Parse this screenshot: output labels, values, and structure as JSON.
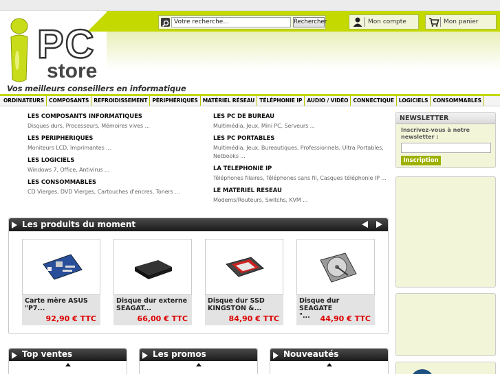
{
  "header": {
    "logo_alt": "PC store",
    "tagline": "Vos meilleurs conseillers en informatique",
    "search_placeholder": "Votre recherche...",
    "search_button": "Rechercher",
    "account_label": "Mon compte",
    "cart_label": "Mon panier"
  },
  "nav": [
    "ORDINATEURS",
    "COMPOSANTS",
    "REFROIDISSEMENT",
    "PÉRIPHÉRIQUES",
    "MATÉRIEL RÉSEAU",
    "TÉLÉPHONIE IP",
    "AUDIO / VIDÉO",
    "CONNECTIQUE",
    "LOGICIELS",
    "CONSOMMABLES"
  ],
  "categories_left": [
    {
      "title": "LES COMPOSANTS INFORMATIQUES",
      "sub": "Disques durs, Processeurs, Mémoires vives ..."
    },
    {
      "title": "LES PERIPHERIQUES",
      "sub": "Moniteurs LCD, Imprimantes ..."
    },
    {
      "title": "LES LOGICIELS",
      "sub": "Windows 7, Office, Antivirus ..."
    },
    {
      "title": "LES CONSOMMABLES",
      "sub": "CD Vierges, DVD Vierges, Cartouches d'encres, Toners ..."
    }
  ],
  "categories_right": [
    {
      "title": "LES PC DE BUREAU",
      "sub": "Multimédia, Jeux, Mini PC, Serveurs ..."
    },
    {
      "title": "LES PC PORTABLES",
      "sub": "Multimédia, Jeux, Bureautiques, Professionnels, Ultra Portables,",
      "sub2": "Netbooks ..."
    },
    {
      "title": "LA TELEPHONIE IP",
      "sub": "Téléphones filaires, Téléphones sans fil, Casques téléphonie IP ..."
    },
    {
      "title": "LE MATERIEL RESEAU",
      "sub": "Modems/Routeurs, Switchs, KVM ..."
    }
  ],
  "featured": {
    "title": "Les produits du moment",
    "products": [
      {
        "name_line1": "Carte mère ASUS",
        "name_line2": "\"P7...",
        "price": "92,90 € TTC"
      },
      {
        "name_line1": "Disque dur externe",
        "name_line2": "SEAGAT...",
        "price": "66,00 € TTC"
      },
      {
        "name_line1": "Disque dur SSD",
        "name_line2": "KINGSTON &...",
        "price": "84,90 € TTC"
      },
      {
        "name_line1": "Disque dur SEAGATE",
        "name_line2": "\"...",
        "price": "44,90 € TTC"
      }
    ]
  },
  "bottom_boxes": [
    "Top ventes",
    "Les promos",
    "Nouveautés"
  ],
  "newsletter": {
    "title": "NEWSLETTER",
    "text": "Inscrivez-vous à notre newsletter :",
    "button": "Inscription"
  },
  "colors": {
    "accent": "#c3d900",
    "price": "#dd0000",
    "panel_head": "#1a1a1a"
  }
}
